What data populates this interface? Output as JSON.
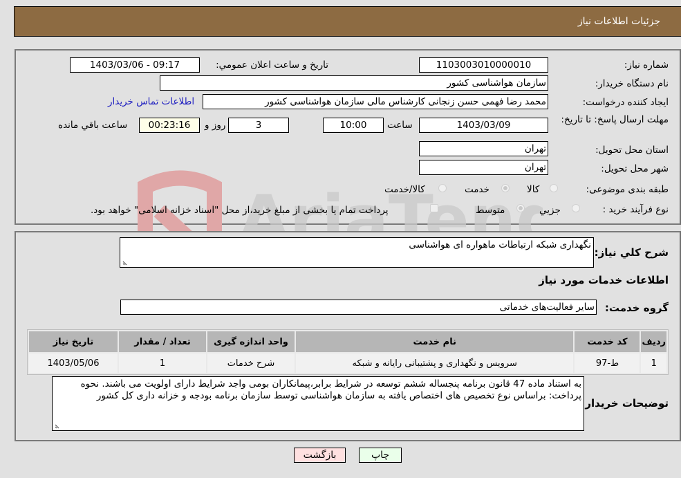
{
  "header": {
    "title": "جزئیات اطلاعات نیاز"
  },
  "form": {
    "need_number": {
      "label": "شماره نیاز:",
      "value": "1103003010000010"
    },
    "announce_datetime": {
      "label": "تاریخ و ساعت اعلان عمومي:",
      "value": "1403/03/06 - 09:17"
    },
    "buyer_org": {
      "label": "نام دستگاه خریدار:",
      "value": "سازمان هواشناسی کشور"
    },
    "requester": {
      "label": "ایجاد کننده درخواست:",
      "value": "محمد رضا فهمی حسن زنجانی کارشناس مالی سازمان هواشناسی کشور"
    },
    "buyer_contact_link": "اطلاعات تماس خریدار",
    "deadline": {
      "label": "مهلت ارسال پاسخ: تا تاریخ:",
      "date": "1403/03/09",
      "time_label": "ساعت",
      "time": "10:00",
      "days": "3",
      "days_label": "روز و",
      "remaining": "00:23:16",
      "remaining_label": "ساعت باقي مانده"
    },
    "province": {
      "label": "استان محل تحویل:",
      "value": "تهران"
    },
    "city": {
      "label": "شهر محل تحویل:",
      "value": "تهران"
    },
    "category": {
      "label": "طبقه بندی موضوعی:",
      "options": [
        "کالا",
        "خدمت",
        "کالا/خدمت"
      ],
      "selected": "خدمت"
    },
    "purchase_type": {
      "label": "نوع فرآیند خرید :",
      "options": [
        "جزيي",
        "متوسط"
      ],
      "selected": "متوسط",
      "treasury_note": "پرداخت تمام یا بخشی از مبلغ خرید،از محل \"اسناد خزانه اسلامی\" خواهد بود.",
      "treasury_checked": false
    }
  },
  "details": {
    "summary_label": "شرح کلي نیاز:",
    "summary_value": "نگهداری شبکه ارتباطات ماهواره ای هواشناسی",
    "services_heading": "اطلاعات خدمات مورد نیاز",
    "service_group_label": "گروه خدمت:",
    "service_group_value": "سایر فعالیت‌های خدماتی",
    "table": {
      "headers": [
        "ردیف",
        "کد خدمت",
        "نام خدمت",
        "واحد اندازه گیری",
        "تعداد / مقدار",
        "تاریخ نیاز"
      ],
      "rows": [
        [
          "1",
          "ط-97",
          "سرویس و نگهداری و پشتیبانی رایانه و شبکه",
          "شرح خدمات",
          "1",
          "1403/05/06"
        ]
      ]
    },
    "buyer_notes_label": "توضیحات خریدار:",
    "buyer_notes_value": "به استناد ماده 47 قانون برنامه پنجساله ششم توسعه در شرایط برابر،پیمانکاران بومی واجد شرایط دارای اولویت می باشند. نحوه پرداخت: براساس نوع تخصیص های اختصاص یافته به سازمان هواشناسی توسط سازمان برنامه بودجه و خزانه داری کل کشور"
  },
  "buttons": {
    "print": "چاپ",
    "back": "بازگشت"
  },
  "colors": {
    "header_bg": "#8d6b42",
    "print_bg": "#eaffea",
    "back_bg": "#ffe0e0",
    "link": "#2020c0"
  },
  "watermark": "AriaTender.neT"
}
